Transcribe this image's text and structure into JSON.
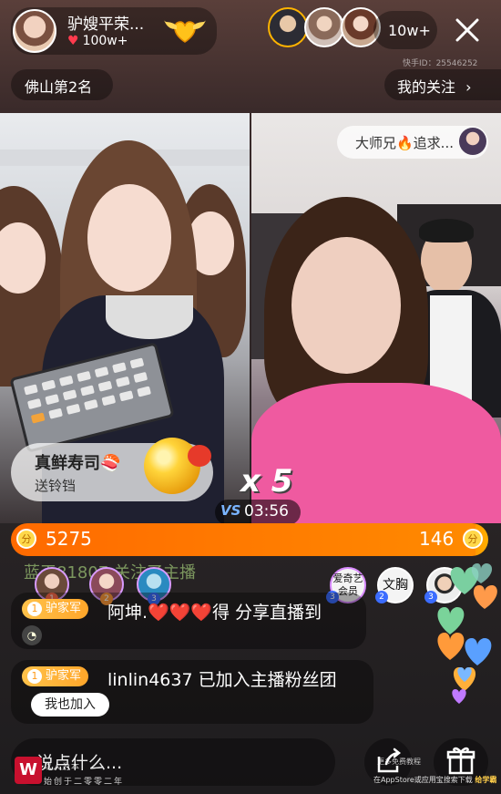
{
  "host": {
    "name": "驴嫂平荣...",
    "likes": "100w+"
  },
  "viewers": {
    "count": "10w+"
  },
  "kuaishou_id": "快手ID：25546252",
  "rank_label": "佛山第2名",
  "follow_label": "我的关注",
  "opponent_tag": "大师兄🔥追求...",
  "gift": {
    "title": "真鲜寿司🍣",
    "subtitle": "送铃铛",
    "combo": "x 5"
  },
  "pk": {
    "vs": "VS",
    "timer": "03:56",
    "score_left": "5275",
    "score_right": "146",
    "share_left": 0.973
  },
  "faded_message": "蓝天81807 关注了主播",
  "top_fans": [
    {
      "rank": "3",
      "label": "爱奇艺会员"
    },
    {
      "rank": "2",
      "label": "文胸"
    },
    {
      "rank": "3",
      "label": ""
    }
  ],
  "mini_ranks": [
    "1",
    "2",
    "3"
  ],
  "comments": [
    {
      "level": "1",
      "badge": "驴家军",
      "text": "阿坤.❤️❤️❤️得 分享直播到"
    },
    {
      "level": "1",
      "badge": "驴家军",
      "text": "linlin4637 已加入主播粉丝团"
    }
  ],
  "join_button": "我也加入",
  "input_placeholder": "说点什么...",
  "watermark": {
    "logo_text": "W",
    "slogan_line1": "以人为本",
    "slogan_line2": "始创于二零零二年",
    "right_line1": "更多免费教程",
    "right_prefix": "在AppStore或应用宝搜索下载",
    "right_brand": "给学霸"
  },
  "colors": {
    "pk_left": "#ff6a00",
    "pk_right": "#ffb000",
    "fan_badge": "#ffa62a",
    "accent_heart": "#ff3b4e"
  }
}
